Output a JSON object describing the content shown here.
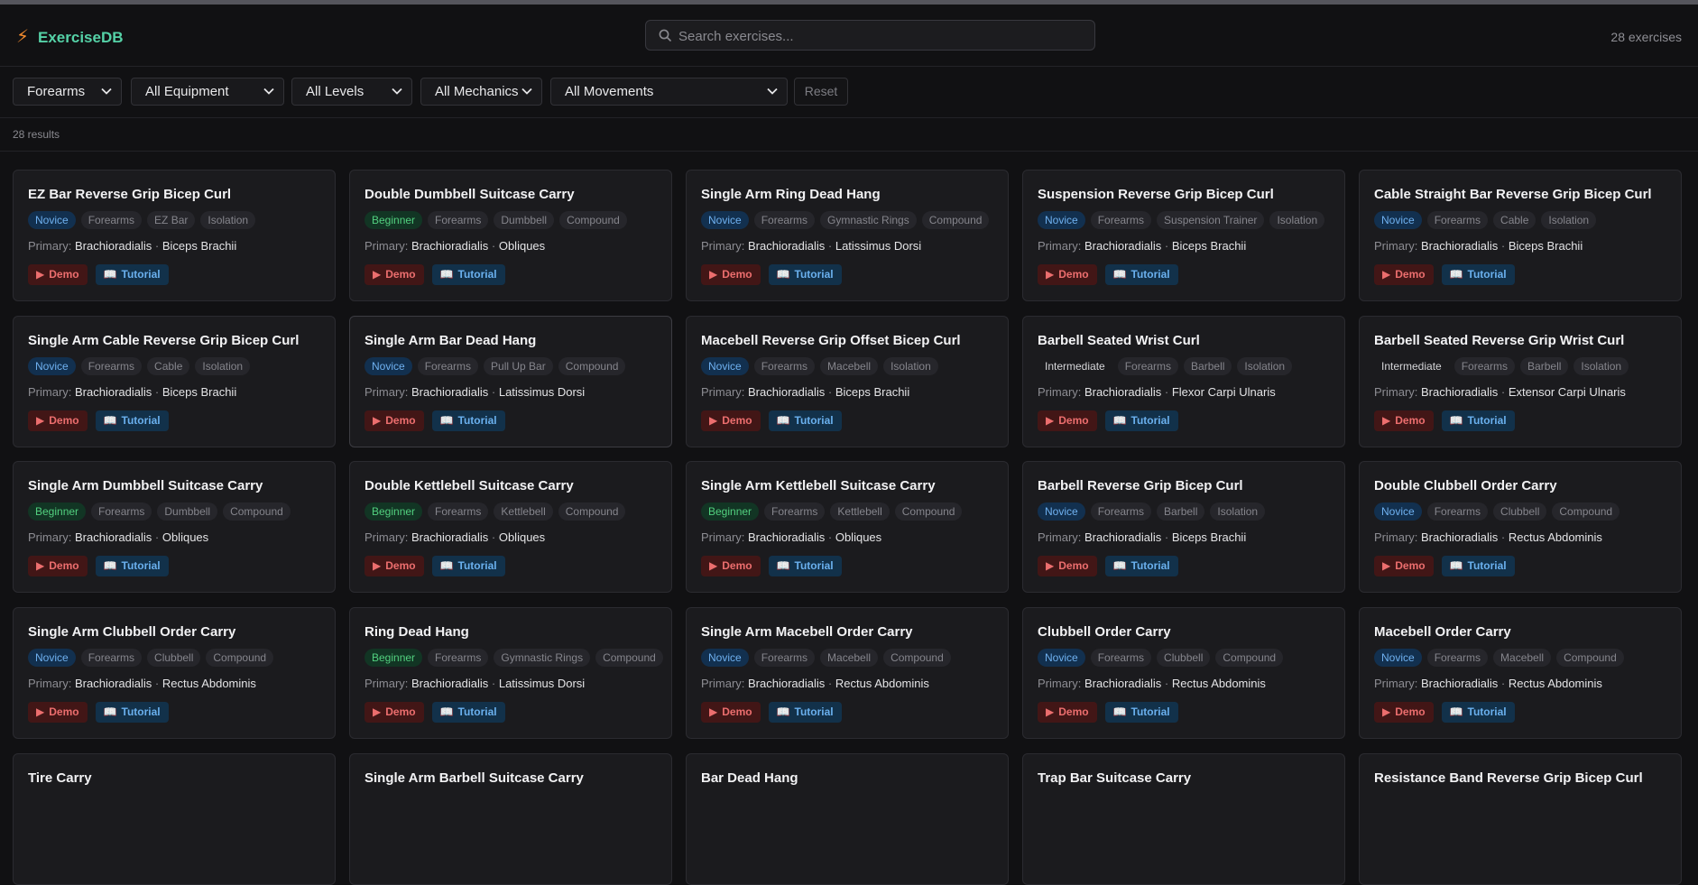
{
  "app": {
    "title": "ExerciseDB",
    "logo_icon": "lightning-bolt-icon",
    "brand_color": "#55d2a7"
  },
  "search": {
    "placeholder": "Search exercises..."
  },
  "exercise_count": "28 exercises",
  "filters": {
    "muscle": "Forearms",
    "equipment": "All Equipment",
    "level": "All Levels",
    "mechanics": "All Mechanics",
    "movements": "All Movements",
    "reset_label": "Reset"
  },
  "results_count": "28 results",
  "labels": {
    "primary": "Primary:",
    "demo": "Demo",
    "tutorial": "Tutorial"
  },
  "level_colors": {
    "Novice": "#6fb1f0",
    "Beginner": "#52d07f",
    "Intermediate": "#d6d6d9"
  },
  "exercises": [
    {
      "name": "EZ Bar Reverse Grip Bicep Curl",
      "level": "Novice",
      "muscle": "Forearms",
      "equipment": "EZ Bar",
      "mechanics": "Isolation",
      "primary": [
        "Brachioradialis",
        "Biceps Brachii"
      ]
    },
    {
      "name": "Double Dumbbell Suitcase Carry",
      "level": "Beginner",
      "muscle": "Forearms",
      "equipment": "Dumbbell",
      "mechanics": "Compound",
      "primary": [
        "Brachioradialis",
        "Obliques"
      ]
    },
    {
      "name": "Single Arm Ring Dead Hang",
      "level": "Novice",
      "muscle": "Forearms",
      "equipment": "Gymnastic Rings",
      "mechanics": "Compound",
      "primary": [
        "Brachioradialis",
        "Latissimus Dorsi"
      ]
    },
    {
      "name": "Suspension Reverse Grip Bicep Curl",
      "level": "Novice",
      "muscle": "Forearms",
      "equipment": "Suspension Trainer",
      "mechanics": "Isolation",
      "primary": [
        "Brachioradialis",
        "Biceps Brachii"
      ]
    },
    {
      "name": "Cable Straight Bar Reverse Grip Bicep Curl",
      "level": "Novice",
      "muscle": "Forearms",
      "equipment": "Cable",
      "mechanics": "Isolation",
      "primary": [
        "Brachioradialis",
        "Biceps Brachii"
      ]
    },
    {
      "name": "Single Arm Cable Reverse Grip Bicep Curl",
      "level": "Novice",
      "muscle": "Forearms",
      "equipment": "Cable",
      "mechanics": "Isolation",
      "primary": [
        "Brachioradialis",
        "Biceps Brachii"
      ]
    },
    {
      "name": "Single Arm Bar Dead Hang",
      "level": "Novice",
      "muscle": "Forearms",
      "equipment": "Pull Up Bar",
      "mechanics": "Compound",
      "primary": [
        "Brachioradialis",
        "Latissimus Dorsi"
      ]
    },
    {
      "name": "Macebell Reverse Grip Offset Bicep Curl",
      "level": "Novice",
      "muscle": "Forearms",
      "equipment": "Macebell",
      "mechanics": "Isolation",
      "primary": [
        "Brachioradialis",
        "Biceps Brachii"
      ]
    },
    {
      "name": "Barbell Seated Wrist Curl",
      "level": "Intermediate",
      "muscle": "Forearms",
      "equipment": "Barbell",
      "mechanics": "Isolation",
      "primary": [
        "Brachioradialis",
        "Flexor Carpi Ulnaris"
      ]
    },
    {
      "name": "Barbell Seated Reverse Grip Wrist Curl",
      "level": "Intermediate",
      "muscle": "Forearms",
      "equipment": "Barbell",
      "mechanics": "Isolation",
      "primary": [
        "Brachioradialis",
        "Extensor Carpi Ulnaris"
      ]
    },
    {
      "name": "Single Arm Dumbbell Suitcase Carry",
      "level": "Beginner",
      "muscle": "Forearms",
      "equipment": "Dumbbell",
      "mechanics": "Compound",
      "primary": [
        "Brachioradialis",
        "Obliques"
      ]
    },
    {
      "name": "Double Kettlebell Suitcase Carry",
      "level": "Beginner",
      "muscle": "Forearms",
      "equipment": "Kettlebell",
      "mechanics": "Compound",
      "primary": [
        "Brachioradialis",
        "Obliques"
      ]
    },
    {
      "name": "Single Arm Kettlebell Suitcase Carry",
      "level": "Beginner",
      "muscle": "Forearms",
      "equipment": "Kettlebell",
      "mechanics": "Compound",
      "primary": [
        "Brachioradialis",
        "Obliques"
      ]
    },
    {
      "name": "Barbell Reverse Grip Bicep Curl",
      "level": "Novice",
      "muscle": "Forearms",
      "equipment": "Barbell",
      "mechanics": "Isolation",
      "primary": [
        "Brachioradialis",
        "Biceps Brachii"
      ]
    },
    {
      "name": "Double Clubbell Order Carry",
      "level": "Novice",
      "muscle": "Forearms",
      "equipment": "Clubbell",
      "mechanics": "Compound",
      "primary": [
        "Brachioradialis",
        "Rectus Abdominis"
      ]
    },
    {
      "name": "Single Arm Clubbell Order Carry",
      "level": "Novice",
      "muscle": "Forearms",
      "equipment": "Clubbell",
      "mechanics": "Compound",
      "primary": [
        "Brachioradialis",
        "Rectus Abdominis"
      ]
    },
    {
      "name": "Ring Dead Hang",
      "level": "Beginner",
      "muscle": "Forearms",
      "equipment": "Gymnastic Rings",
      "mechanics": "Compound",
      "primary": [
        "Brachioradialis",
        "Latissimus Dorsi"
      ]
    },
    {
      "name": "Single Arm Macebell Order Carry",
      "level": "Novice",
      "muscle": "Forearms",
      "equipment": "Macebell",
      "mechanics": "Compound",
      "primary": [
        "Brachioradialis",
        "Rectus Abdominis"
      ]
    },
    {
      "name": "Clubbell Order Carry",
      "level": "Novice",
      "muscle": "Forearms",
      "equipment": "Clubbell",
      "mechanics": "Compound",
      "primary": [
        "Brachioradialis",
        "Rectus Abdominis"
      ]
    },
    {
      "name": "Macebell Order Carry",
      "level": "Novice",
      "muscle": "Forearms",
      "equipment": "Macebell",
      "mechanics": "Compound",
      "primary": [
        "Brachioradialis",
        "Rectus Abdominis"
      ]
    },
    {
      "name": "Tire Carry"
    },
    {
      "name": "Single Arm Barbell Suitcase Carry"
    },
    {
      "name": "Bar Dead Hang"
    },
    {
      "name": "Trap Bar Suitcase Carry"
    },
    {
      "name": "Resistance Band Reverse Grip Bicep Curl"
    }
  ]
}
